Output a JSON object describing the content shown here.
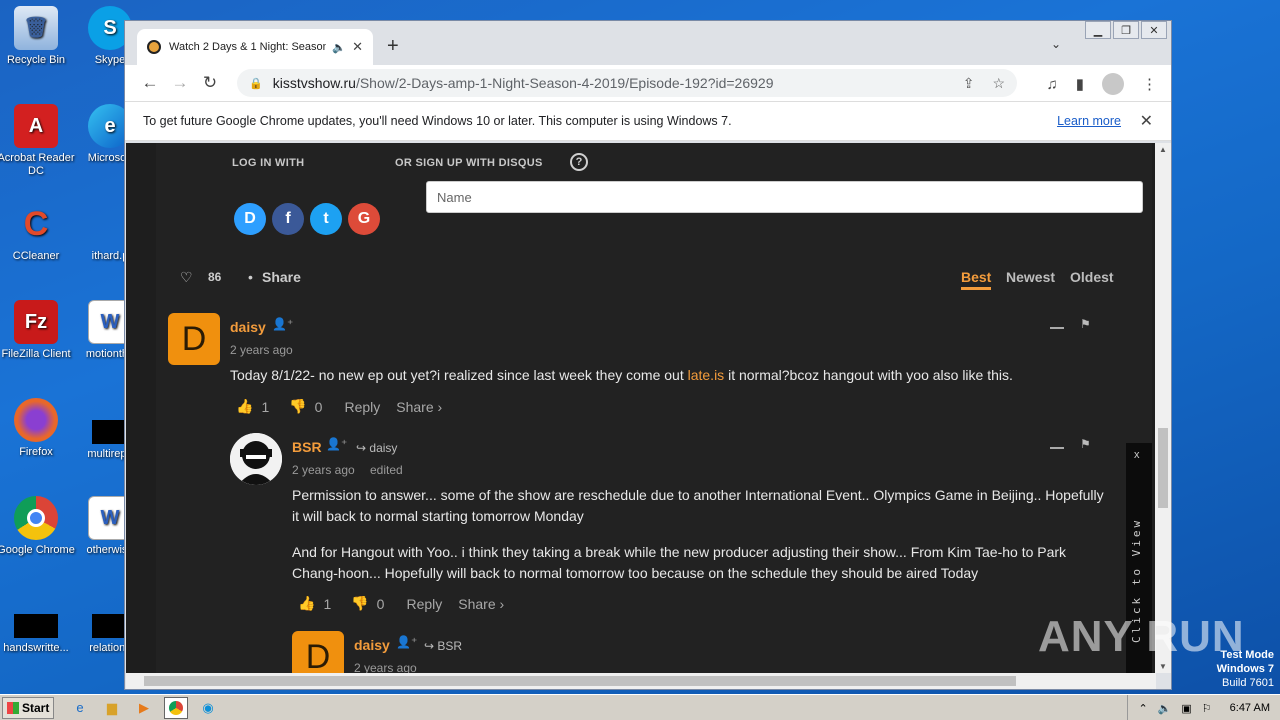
{
  "desktop": {
    "icons": [
      {
        "label": "Recycle Bin",
        "icon": "recycle-bin-icon",
        "color": "#7aa6d8"
      },
      {
        "label": "Skype",
        "icon": "skype-icon",
        "color": "#0aa0e6"
      },
      {
        "label": "Acrobat Reader DC",
        "icon": "acrobat-icon",
        "color": "#d32020"
      },
      {
        "label": "Microsoft",
        "icon": "edge-icon",
        "color": "#0b8fd8"
      },
      {
        "label": "CCleaner",
        "icon": "ccleaner-icon",
        "color": "#e24a2a"
      },
      {
        "label": "ithard.p",
        "icon": "file-icon",
        "color": "#1a6cc8"
      },
      {
        "label": "FileZilla Client",
        "icon": "filezilla-icon",
        "color": "#c81a1a"
      },
      {
        "label": "motiontha",
        "icon": "word-doc-icon",
        "color": "#2b5fbe"
      },
      {
        "label": "Firefox",
        "icon": "firefox-icon",
        "color": "#e8672a"
      },
      {
        "label": "multirepo",
        "icon": "black-file-icon",
        "color": "#000000"
      },
      {
        "label": "Google Chrome",
        "icon": "chrome-icon",
        "color": "#3a8e3a"
      },
      {
        "label": "otherwise",
        "icon": "word-doc-icon",
        "color": "#2b5fbe"
      },
      {
        "label": "handswritte...",
        "icon": "black-file-icon",
        "color": "#000000"
      },
      {
        "label": "relations",
        "icon": "black-file-icon",
        "color": "#000000"
      }
    ]
  },
  "browser": {
    "tab_title": "Watch 2 Days & 1 Night: Season",
    "url_host": "kisstvshow.ru",
    "url_path": "/Show/2-Days-amp-1-Night-Season-4-2019/Episode-192?id=26929",
    "infobar_text": "To get future Google Chrome updates, you'll need Windows 10 or later. This computer is using Windows 7.",
    "infobar_link": "Learn more"
  },
  "disqus": {
    "login_label": "LOG IN WITH",
    "signup_label": "OR SIGN UP WITH DISQUS",
    "name_placeholder": "Name",
    "likes": "86",
    "share": "Share",
    "sort_best": "Best",
    "sort_newest": "Newest",
    "sort_oldest": "Oldest",
    "comments": [
      {
        "user": "daisy",
        "time": "2 years ago",
        "text_before": "Today 8/1/22- no new ep out yet?i realized since last week they come out ",
        "link": "late.is",
        "text_after": " it normal?bcoz hangout with yoo also like this.",
        "up": "1",
        "down": "0",
        "reply": "Reply",
        "share": "Share ›"
      },
      {
        "user": "BSR",
        "reply_to": "daisy",
        "time": "2 years ago",
        "edited": "edited",
        "para1": "Permission to answer... some of the show are reschedule due to another International Event.. Olympics Game in Beijing.. Hopefully it will back to normal starting tomorrow Monday",
        "para2": "And for Hangout with Yoo.. i think they taking a break while the new producer adjusting their show... From Kim Tae-ho to Park Chang-hoon... Hopefully will back to normal tomorrow too because on the schedule they should be aired Today",
        "up": "1",
        "down": "0",
        "reply": "Reply",
        "share": "Share ›"
      },
      {
        "user": "daisy",
        "reply_to": "BSR",
        "time": "2 years ago"
      }
    ],
    "popup_close": "x",
    "popup_text": "Click to View"
  },
  "overlay": {
    "watermark": "ANY RUN",
    "testmode_line1": "Test Mode",
    "testmode_line2": "Windows 7",
    "testmode_line3": "Build 7601"
  },
  "taskbar": {
    "start": "Start",
    "clock": "6:47 AM"
  }
}
